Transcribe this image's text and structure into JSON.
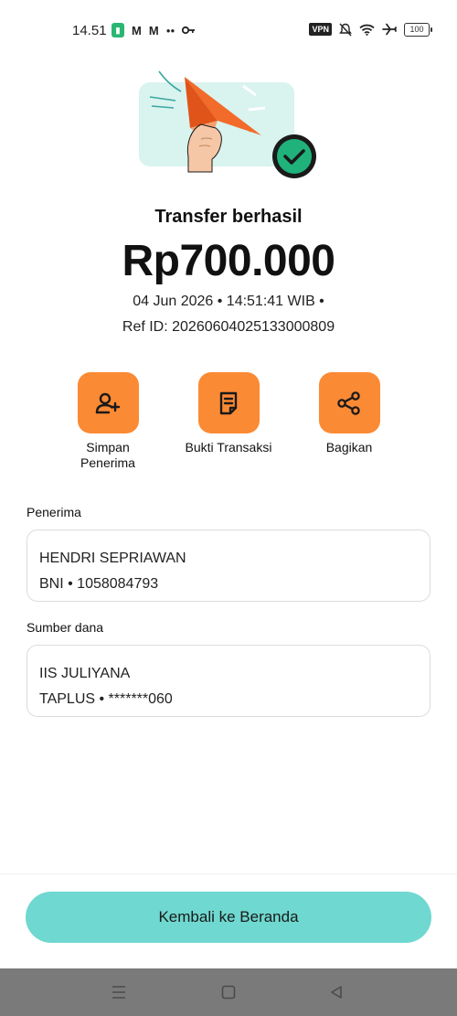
{
  "status_bar": {
    "time": "14.51",
    "vpn_label": "VPN",
    "battery_level": "100",
    "icons": [
      "battery-app-icon",
      "gmail-icon",
      "gmail-icon",
      "notification-icon",
      "key-icon",
      "vpn-icon",
      "mute-icon",
      "wifi-icon",
      "airplane-icon",
      "battery-icon"
    ]
  },
  "result": {
    "title": "Transfer berhasil",
    "amount": "Rp700.000",
    "datetime": "04 Jun 2026 • 14:51:41 WIB •",
    "ref_id": "Ref ID: 20260604025133000809"
  },
  "actions": [
    {
      "label_line1": "Simpan",
      "label_line2": "Penerima",
      "icon": "add-user-icon"
    },
    {
      "label_line1": "Bukti Transaksi",
      "label_line2": "",
      "icon": "receipt-icon"
    },
    {
      "label_line1": "Bagikan",
      "label_line2": "",
      "icon": "share-icon"
    }
  ],
  "recipient": {
    "label": "Penerima",
    "name": "HENDRI SEPRIAWAN",
    "account": "BNI • 1058084793"
  },
  "source": {
    "label": "Sumber dana",
    "name": "IIS JULIYANA",
    "account": "TAPLUS • *******060"
  },
  "home_button": "Kembali ke Beranda",
  "nav": [
    "menu-icon",
    "home-square-icon",
    "back-triangle-icon"
  ],
  "colors": {
    "accent_orange": "#fb8a34",
    "button_teal": "#6fd8d0",
    "success_green": "#1fb37b",
    "nav_gray": "#7a7a7a"
  }
}
